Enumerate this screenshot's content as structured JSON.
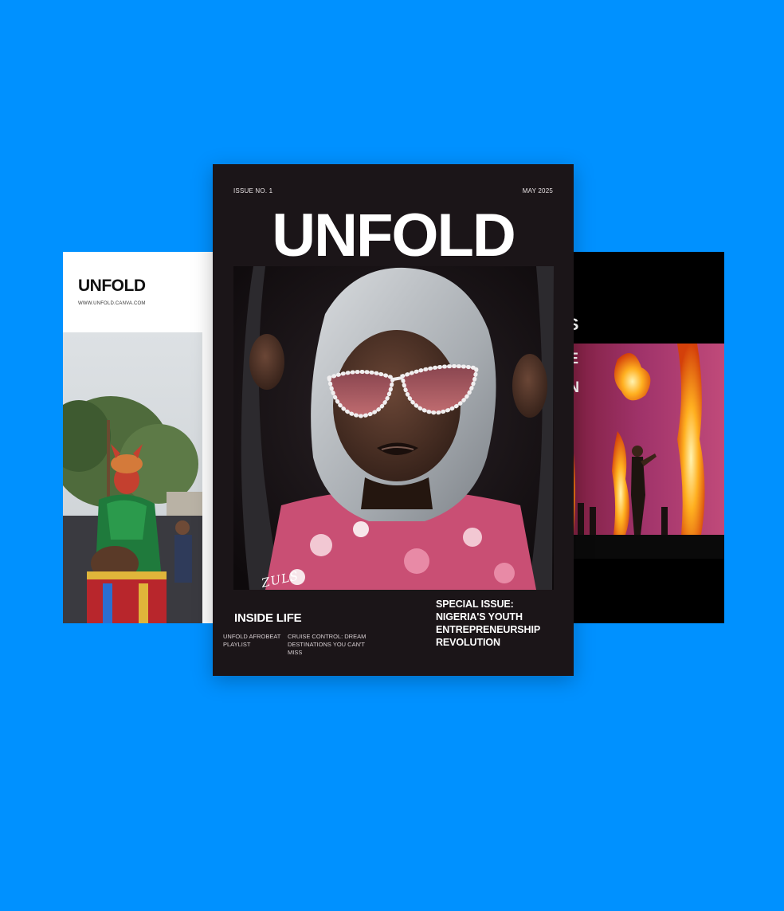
{
  "background_color": "#0091FF",
  "left_cover": {
    "brand": "UNFOLD",
    "url": "WWW.UNFOLD.CANVA.COM"
  },
  "right_cover": {
    "heading_fragment": "TS",
    "overlay_fragment": "HE\nN\nAN"
  },
  "main_cover": {
    "issue": "ISSUE NO. 1",
    "date": "MAY 2025",
    "brand": "UNFOLD",
    "signature": "ZULS",
    "inside_heading": "INSIDE LIFE",
    "story_1": "UNFOLD AFROBEAT PLAYLIST",
    "story_2": "CRUISE CONTROL: DREAM DESTINATIONS YOU CAN'T MISS",
    "special_issue": "SPECIAL ISSUE: NIGERIA'S YOUTH ENTREPRENEURSHIP REVOLUTION"
  }
}
